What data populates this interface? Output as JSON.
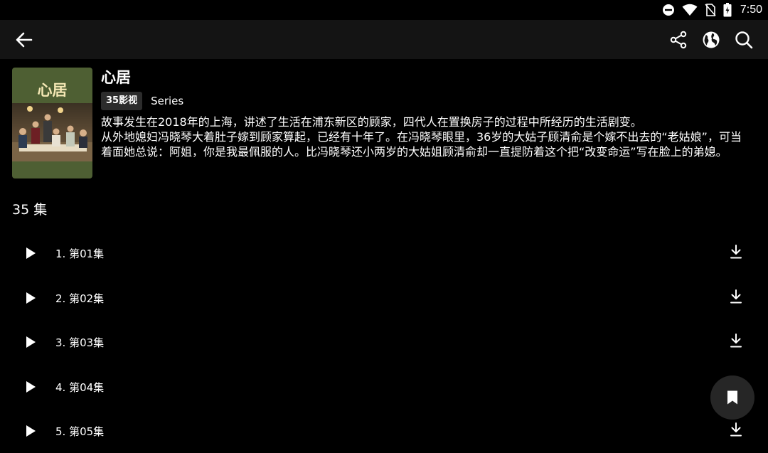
{
  "status_bar": {
    "time": "7:50",
    "icons": [
      "do-not-disturb-icon",
      "wifi-icon",
      "no-sim-icon",
      "battery-icon"
    ]
  },
  "app_bar": {
    "icons": [
      "back-arrow-icon",
      "share-icon",
      "globe-icon",
      "search-icon"
    ]
  },
  "show": {
    "poster_text": "心居",
    "title": "心居",
    "badge": "35影视",
    "type": "Series",
    "description": [
      "故事发生在2018年的上海，讲述了生活在浦东新区的顾家，四代人在置换房子的过程中所经历的生活剧变。",
      "从外地媳妇冯晓琴大着肚子嫁到顾家算起，已经有十年了。在冯晓琴眼里，36岁的大姑子顾清俞是个嫁不出去的“老姑娘”，可当着面她总说：阿姐，你是我最佩服的人。比冯晓琴还小两岁的大姑姐顾清俞却一直提防着这个把“改变命运”写在脸上的弟媳。"
    ]
  },
  "episode_count": "35 集",
  "episodes": [
    {
      "label": "1. 第01集"
    },
    {
      "label": "2. 第02集"
    },
    {
      "label": "3. 第03集"
    },
    {
      "label": "4. 第04集"
    },
    {
      "label": "5. 第05集"
    }
  ],
  "colors": {
    "background": "#000000",
    "app_bar": "#141414",
    "badge_bg": "#2c2c2c",
    "fab_bg": "#262626",
    "poster_bg": "#4e5f33"
  },
  "fab": {
    "icon": "bookmark-icon"
  }
}
